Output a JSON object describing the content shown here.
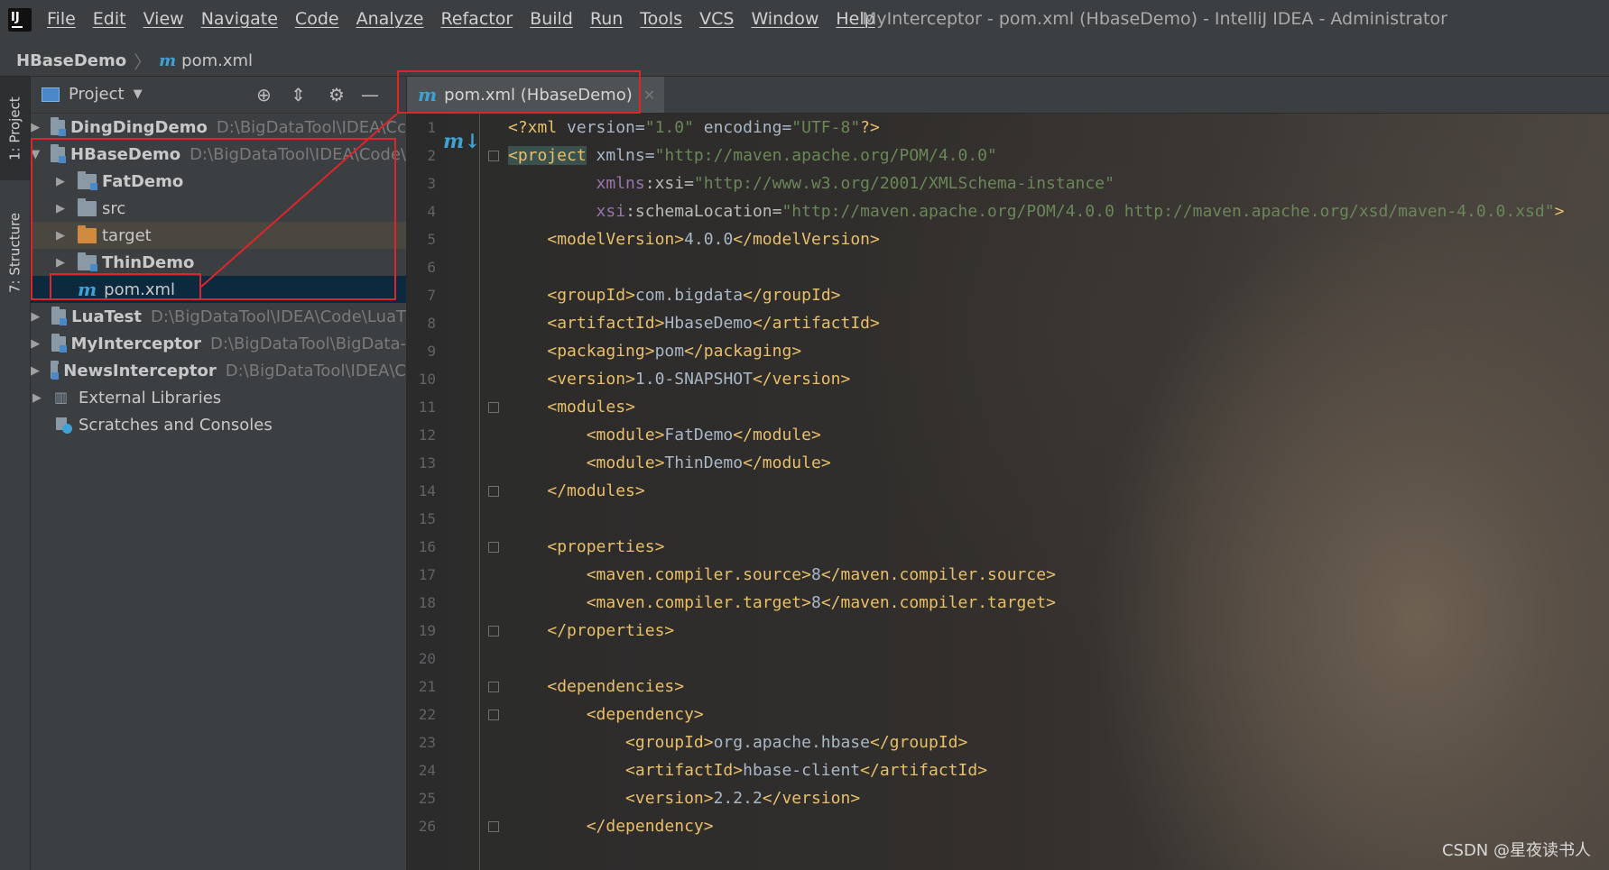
{
  "window": {
    "title": "MyInterceptor - pom.xml (HbaseDemo) - IntelliJ IDEA - Administrator",
    "menu": [
      "File",
      "Edit",
      "View",
      "Navigate",
      "Code",
      "Analyze",
      "Refactor",
      "Build",
      "Run",
      "Tools",
      "VCS",
      "Window",
      "Help"
    ]
  },
  "breadcrumb": {
    "project": "HBaseDemo",
    "file": "pom.xml",
    "file_icon": "m"
  },
  "tool_strip": {
    "project_tab": "1: Project",
    "structure_tab": "7: Structure"
  },
  "project_panel": {
    "title": "Project",
    "tree": [
      {
        "label": "DingDingDemo",
        "path": "D:\\BigDataTool\\IDEA\\Cc"
      },
      {
        "label": "HBaseDemo",
        "path": "D:\\BigDataTool\\IDEA\\Code\\"
      },
      {
        "label": "FatDemo"
      },
      {
        "label": "src"
      },
      {
        "label": "target"
      },
      {
        "label": "ThinDemo"
      },
      {
        "label": "pom.xml",
        "icon": "m"
      },
      {
        "label": "LuaTest",
        "path": "D:\\BigDataTool\\IDEA\\Code\\LuaT"
      },
      {
        "label": "MyInterceptor",
        "path": "D:\\BigDataTool\\BigData-"
      },
      {
        "label": "NewsInterceptor",
        "path": "D:\\BigDataTool\\IDEA\\C"
      },
      {
        "label": "External Libraries"
      },
      {
        "label": "Scratches and Consoles"
      }
    ]
  },
  "editor": {
    "tab_label": "pom.xml (HbaseDemo)",
    "tab_icon": "m",
    "line_numbers": [
      "1",
      "2",
      "3",
      "4",
      "5",
      "6",
      "7",
      "8",
      "9",
      "10",
      "11",
      "12",
      "13",
      "14",
      "15",
      "16",
      "17",
      "18",
      "19",
      "20",
      "21",
      "22",
      "23",
      "24",
      "25",
      "26"
    ],
    "code": [
      "<?xml version=\"1.0\" encoding=\"UTF-8\"?>",
      "<project xmlns=\"http://maven.apache.org/POM/4.0.0\"",
      "         xmlns:xsi=\"http://www.w3.org/2001/XMLSchema-instance\"",
      "         xsi:schemaLocation=\"http://maven.apache.org/POM/4.0.0 http://maven.apache.org/xsd/maven-4.0.0.xsd\">",
      "    <modelVersion>4.0.0</modelVersion>",
      "",
      "    <groupId>com.bigdata</groupId>",
      "    <artifactId>HbaseDemo</artifactId>",
      "    <packaging>pom</packaging>",
      "    <version>1.0-SNAPSHOT</version>",
      "    <modules>",
      "        <module>FatDemo</module>",
      "        <module>ThinDemo</module>",
      "    </modules>",
      "",
      "    <properties>",
      "        <maven.compiler.source>8</maven.compiler.source>",
      "        <maven.compiler.target>8</maven.compiler.target>",
      "    </properties>",
      "",
      "    <dependencies>",
      "        <dependency>",
      "            <groupId>org.apache.hbase</groupId>",
      "            <artifactId>hbase-client</artifactId>",
      "            <version>2.2.2</version>",
      "        </dependency>"
    ]
  },
  "watermark": "CSDN @星夜读书人",
  "colors": {
    "annotation_red": "#e0242b",
    "maven_blue": "#3fa2d6",
    "xml_tag": "#e8bf6a",
    "xml_value": "#6a8759",
    "selection": "#0d293e"
  }
}
